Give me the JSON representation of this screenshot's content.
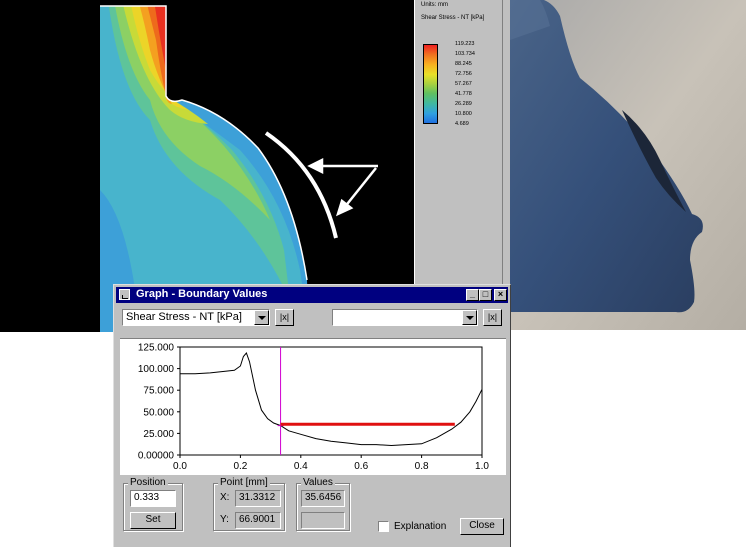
{
  "legend": {
    "units_label": "Units: mm",
    "quantity_label": "Shear Stress - NT  [kPa]",
    "ticks": [
      "119.223",
      "103.734",
      "88.245",
      "72.756",
      "57.267",
      "41.778",
      "26.289",
      "10.800",
      "4.689"
    ]
  },
  "window": {
    "title": "Graph - Boundary Values",
    "minimize_label": "_",
    "maximize_label": "□",
    "close_label": "×"
  },
  "selectors": {
    "primary_value": "Shear Stress - NT  [kPa]",
    "secondary_value": "",
    "abs_label": "|x|"
  },
  "chart_data": {
    "type": "line",
    "xlim": [
      0.0,
      1.0
    ],
    "ylim": [
      0,
      125
    ],
    "x_ticks": [
      "0.0",
      "0.2",
      "0.4",
      "0.6",
      "0.8",
      "1.0"
    ],
    "y_ticks": [
      "125.000",
      "100.000",
      "75.000",
      "50.000",
      "25.000",
      "0.00000"
    ],
    "series": [
      {
        "x": [
          0.0,
          0.05,
          0.1,
          0.15,
          0.18,
          0.2,
          0.21,
          0.22,
          0.23,
          0.25,
          0.27,
          0.29,
          0.31,
          0.333,
          0.36,
          0.4,
          0.45,
          0.5,
          0.55,
          0.6,
          0.65,
          0.7,
          0.75,
          0.8,
          0.85,
          0.9,
          0.93,
          0.96,
          0.98,
          1.0
        ],
        "y": [
          94,
          94,
          95,
          97,
          98,
          103,
          114,
          118,
          108,
          75,
          52,
          42,
          37,
          34,
          28,
          24,
          19,
          16,
          14,
          12,
          12,
          11,
          12,
          13,
          20,
          30,
          38,
          50,
          62,
          76
        ]
      }
    ],
    "cursor_x": 0.333,
    "highlight_segment": {
      "x": [
        0.333,
        0.91
      ],
      "y": 35.6
    }
  },
  "position": {
    "group_label": "Position",
    "value": "0.333",
    "set_label": "Set"
  },
  "point": {
    "group_label": "Point [mm]",
    "x_label": "X:",
    "x_value": "31.3312",
    "y_label": "Y:",
    "y_value": "66.9001"
  },
  "values": {
    "group_label": "Values",
    "value1": "35.6456",
    "value2": ""
  },
  "explanation_label": "Explanation",
  "close_button_label": "Close"
}
